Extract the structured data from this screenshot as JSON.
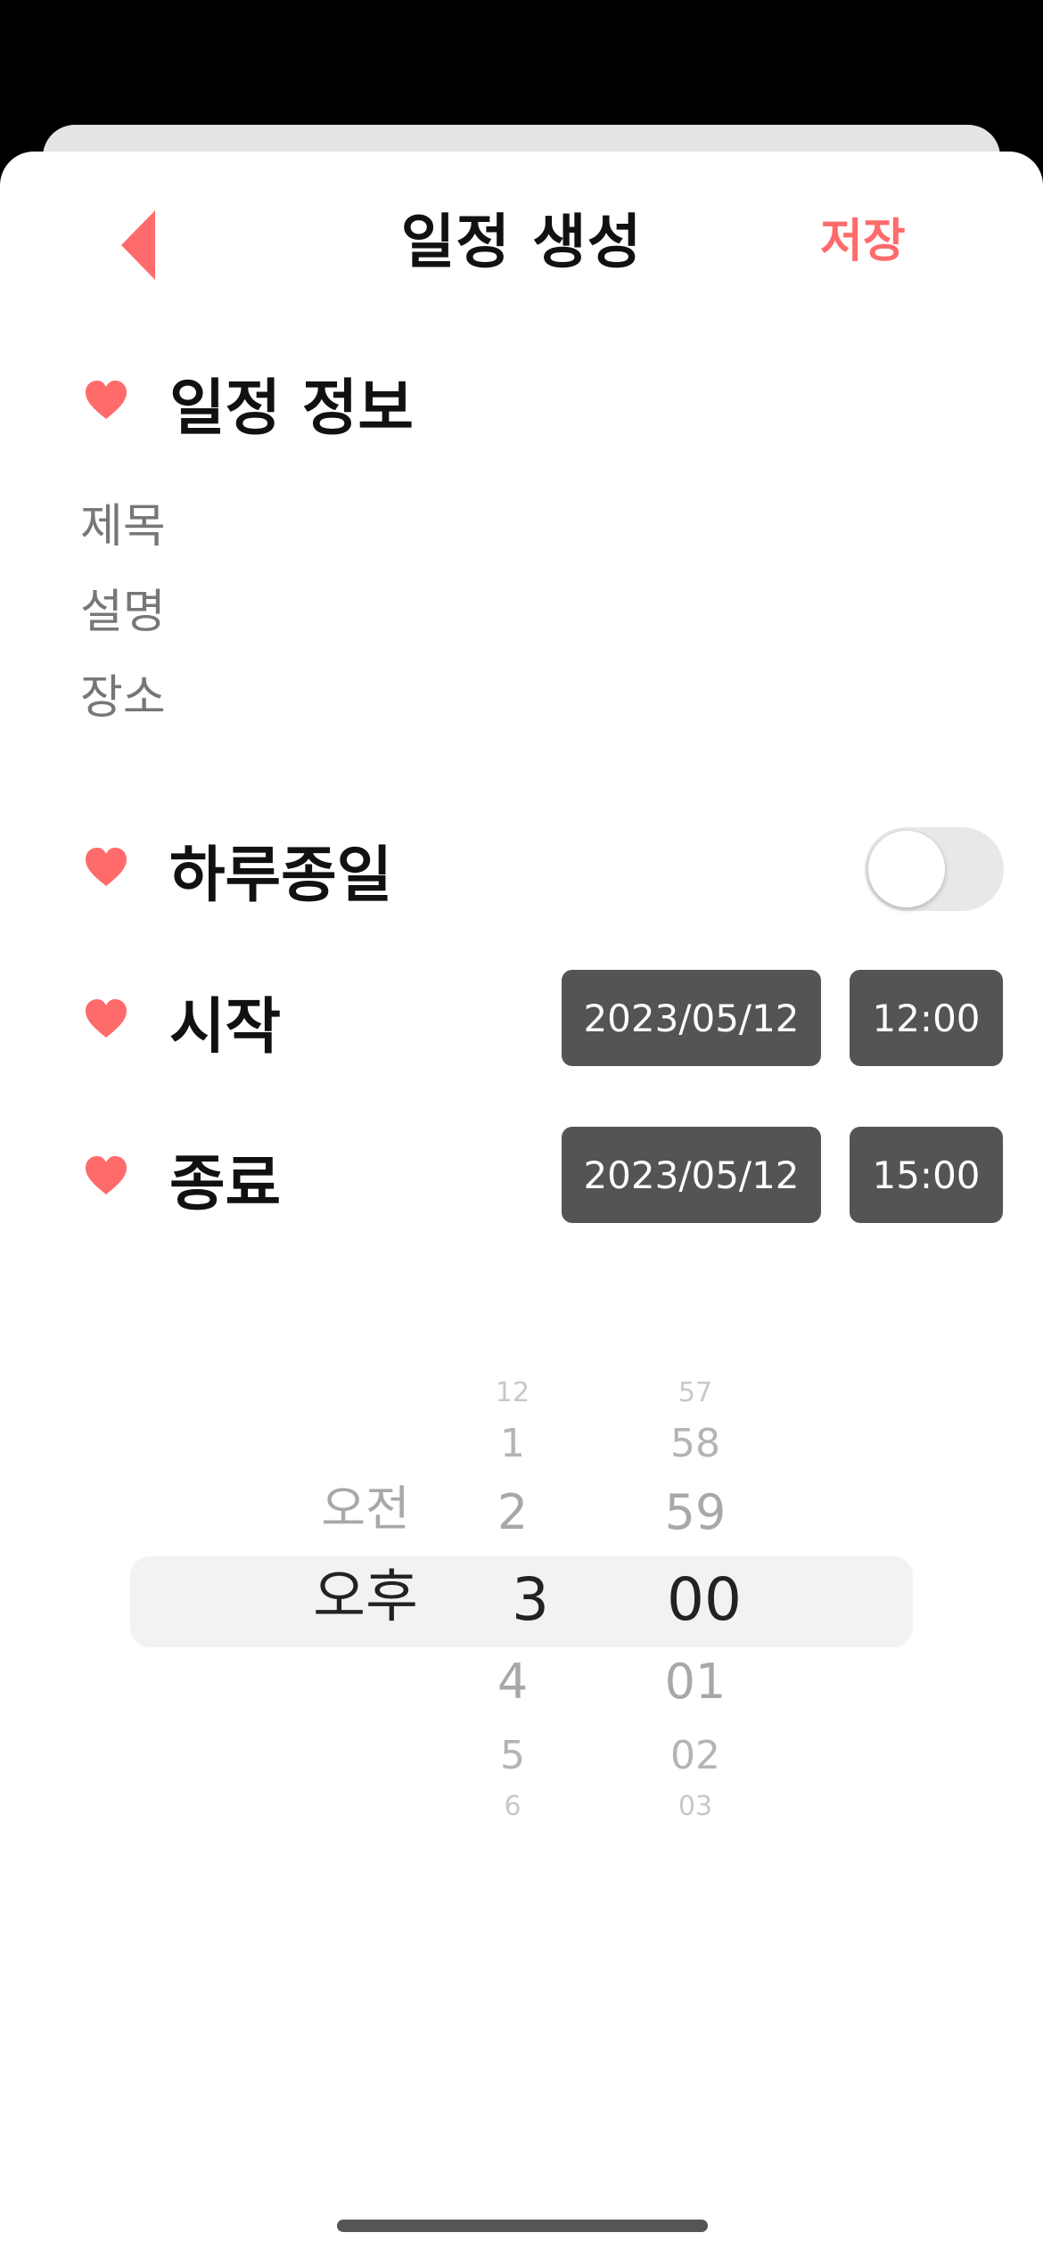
{
  "header": {
    "title": "일정 생성",
    "save_label": "저장",
    "back_icon": "chevron-left-icon"
  },
  "sections": {
    "info_title": "일정 정보",
    "allday_title": "하루종일",
    "start_title": "시작",
    "end_title": "종료"
  },
  "fields": {
    "title": "제목",
    "description": "설명",
    "location": "장소"
  },
  "allday": {
    "on": false
  },
  "start": {
    "date": "2023/05/12",
    "time": "12:00"
  },
  "end": {
    "date": "2023/05/12",
    "time": "15:00"
  },
  "picker": {
    "ampm": {
      "above": "오전",
      "selected": "오후"
    },
    "hours": {
      "far_above": "12",
      "above2": "1",
      "above1": "2",
      "selected": "3",
      "below1": "4",
      "below2": "5",
      "far_below": "6"
    },
    "minutes": {
      "far_above": "57",
      "above2": "58",
      "above1": "59",
      "selected": "00",
      "below1": "01",
      "below2": "02",
      "far_below": "03"
    }
  },
  "colors": {
    "accent": "#ff6b6b",
    "pill": "#545454",
    "label": "#777777"
  }
}
